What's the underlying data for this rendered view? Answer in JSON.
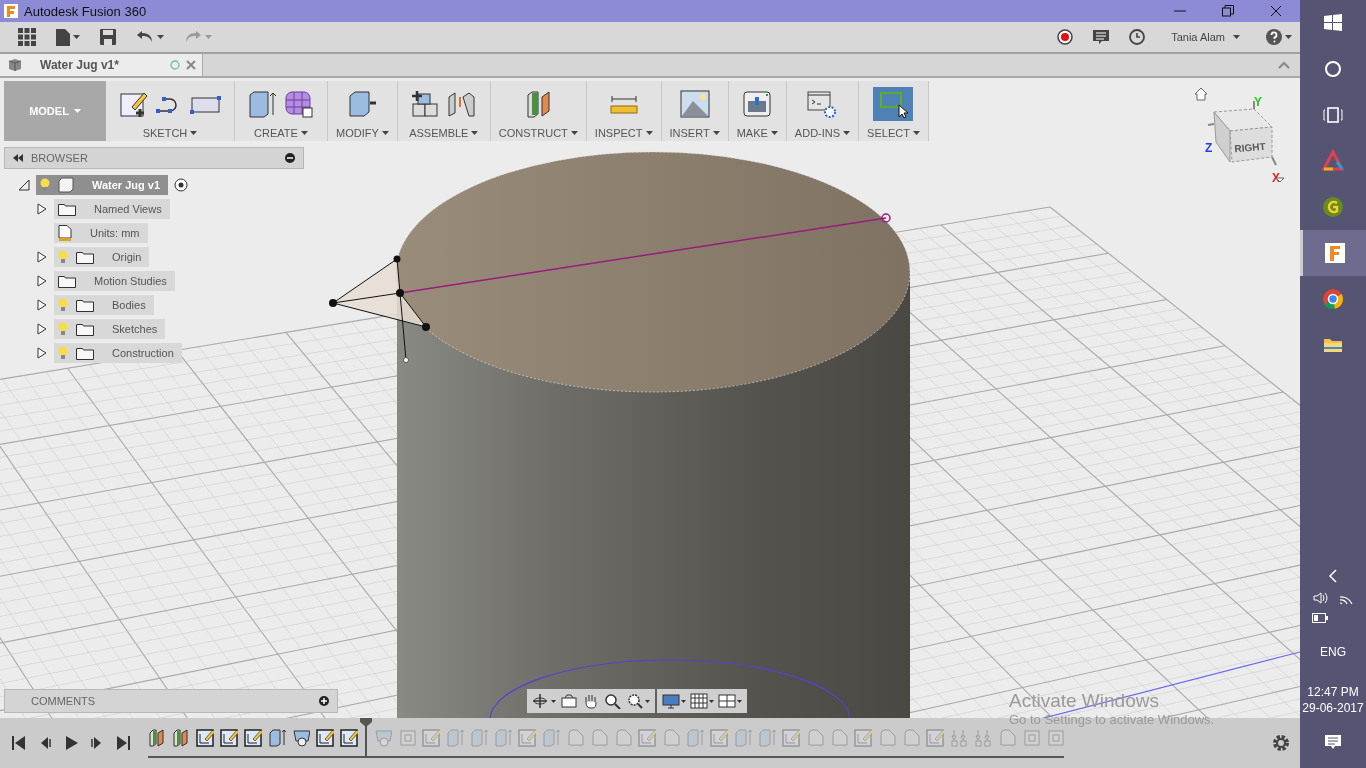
{
  "window": {
    "title": "Autodesk Fusion 360"
  },
  "quick_access": {
    "user": "Tania Alam"
  },
  "document_tab": {
    "title": "Water Jug v1*"
  },
  "ribbon": {
    "workspace": "MODEL",
    "groups": [
      {
        "label": "SKETCH",
        "kind": "sketch",
        "selected": false
      },
      {
        "label": "CREATE",
        "kind": "create",
        "selected": false
      },
      {
        "label": "MODIFY",
        "kind": "modify",
        "selected": false
      },
      {
        "label": "ASSEMBLE",
        "kind": "assemble",
        "selected": false
      },
      {
        "label": "CONSTRUCT",
        "kind": "construct",
        "selected": false
      },
      {
        "label": "INSPECT",
        "kind": "inspect",
        "selected": false
      },
      {
        "label": "INSERT",
        "kind": "insert",
        "selected": false
      },
      {
        "label": "MAKE",
        "kind": "make",
        "selected": false
      },
      {
        "label": "ADD-INS",
        "kind": "addins",
        "selected": false
      },
      {
        "label": "SELECT",
        "kind": "select",
        "selected": true
      }
    ]
  },
  "browser": {
    "title": "BROWSER",
    "root": {
      "label": "Water Jug v1",
      "expanded": true,
      "selected": true,
      "children": [
        {
          "label": "Named Views",
          "kind": "folder",
          "expandable": true,
          "selected": false
        },
        {
          "label": "Units: mm",
          "kind": "units",
          "expandable": false,
          "selected": false
        },
        {
          "label": "Origin",
          "kind": "lit-folder",
          "expandable": true,
          "selected": false
        },
        {
          "label": "Motion Studies",
          "kind": "folder",
          "expandable": true,
          "selected": false
        },
        {
          "label": "Bodies",
          "kind": "lit-folder",
          "expandable": true,
          "selected": false
        },
        {
          "label": "Sketches",
          "kind": "lit-folder",
          "expandable": true,
          "selected": false
        },
        {
          "label": "Construction",
          "kind": "lit-folder",
          "expandable": true,
          "selected": false
        }
      ]
    }
  },
  "view_cube": {
    "face": "RIGHT",
    "axes": [
      {
        "label": "Y",
        "color": "#22cc22"
      },
      {
        "label": "Z",
        "color": "#1f3fe0"
      },
      {
        "label": "X",
        "color": "#e02020"
      }
    ]
  },
  "comments": {
    "title": "COMMENTS"
  },
  "timeline": {
    "features": [
      {
        "kind": "plane",
        "active": true
      },
      {
        "kind": "plane",
        "active": true
      },
      {
        "kind": "sketch",
        "active": true
      },
      {
        "kind": "sketch",
        "active": true
      },
      {
        "kind": "sketch",
        "active": true
      },
      {
        "kind": "extrude",
        "active": true
      },
      {
        "kind": "shell",
        "active": true
      },
      {
        "kind": "sketch",
        "active": true
      },
      {
        "kind": "sketch",
        "active": true
      },
      {
        "kind": "shell",
        "active": false
      },
      {
        "kind": "box",
        "active": false
      },
      {
        "kind": "sketch",
        "active": false
      },
      {
        "kind": "extrude",
        "active": false
      },
      {
        "kind": "extrude",
        "active": false
      },
      {
        "kind": "extrude",
        "active": false
      },
      {
        "kind": "sketch",
        "active": false
      },
      {
        "kind": "extrude",
        "active": false
      },
      {
        "kind": "fillet",
        "active": false
      },
      {
        "kind": "fillet",
        "active": false
      },
      {
        "kind": "fillet",
        "active": false
      },
      {
        "kind": "sketch",
        "active": false
      },
      {
        "kind": "fillet",
        "active": false
      },
      {
        "kind": "extrude",
        "active": false
      },
      {
        "kind": "sketch",
        "active": false
      },
      {
        "kind": "extrude",
        "active": false
      },
      {
        "kind": "extrude",
        "active": false
      },
      {
        "kind": "sketch",
        "active": false
      },
      {
        "kind": "fillet",
        "active": false
      },
      {
        "kind": "fillet",
        "active": false
      },
      {
        "kind": "sketch",
        "active": false
      },
      {
        "kind": "fillet",
        "active": false
      },
      {
        "kind": "fillet",
        "active": false
      },
      {
        "kind": "sketch",
        "active": false
      },
      {
        "kind": "pattern",
        "active": false
      },
      {
        "kind": "pattern",
        "active": false
      },
      {
        "kind": "fillet",
        "active": false
      },
      {
        "kind": "box",
        "active": false
      },
      {
        "kind": "box",
        "active": false
      }
    ]
  },
  "activation": {
    "title": "Activate Windows",
    "subtitle": "Go to Settings to activate Windows."
  },
  "taskbar": {
    "apps": [
      {
        "kind": "start",
        "selected": false
      },
      {
        "kind": "search",
        "selected": false
      },
      {
        "kind": "task-view",
        "selected": false
      },
      {
        "kind": "triangle",
        "selected": false
      },
      {
        "kind": "g-app",
        "selected": false
      },
      {
        "kind": "fusion",
        "selected": true
      },
      {
        "kind": "chrome",
        "selected": false
      },
      {
        "kind": "folder",
        "selected": false
      }
    ],
    "language": "ENG",
    "time": "12:47 PM",
    "date": "29-06-2017"
  }
}
